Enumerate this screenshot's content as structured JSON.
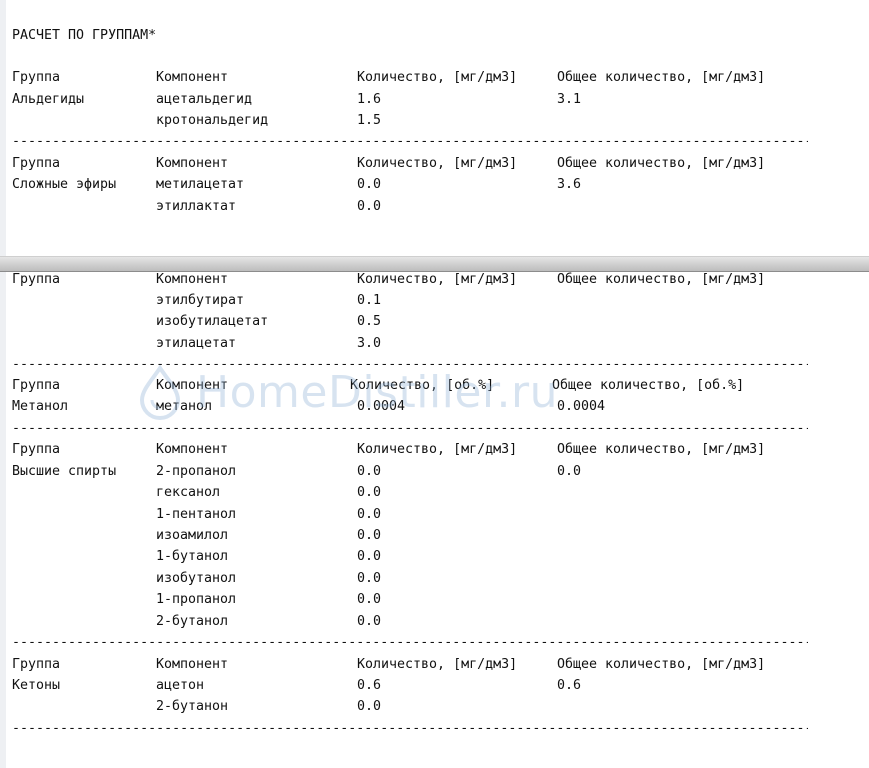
{
  "title": "РАСЧЕТ ПО ГРУППАМ*",
  "header": {
    "group": "Группа",
    "component": "Компонент",
    "qty_mg": "Количество, [мг/дм3]",
    "total_mg": "Общее количество, [мг/дм3]",
    "qty_ob": "Количество, [об.%]",
    "total_ob": "Общее количество, [об.%]"
  },
  "dashes": "-------------------------------------------------------------------------------------------------------------------",
  "aldehydes": {
    "name": "Альдегиды",
    "total": "3.1",
    "rows": [
      {
        "component": "ацетальдегид",
        "qty": "1.6"
      },
      {
        "component": "кротональдегид",
        "qty": "1.5"
      }
    ]
  },
  "esters": {
    "name": "Сложные эфиры",
    "total": "3.6",
    "rows": [
      {
        "component": "метилацетат",
        "qty": "0.0"
      },
      {
        "component": "этиллактат",
        "qty": "0.0"
      },
      {
        "component": "этилбутират",
        "qty": "0.1"
      },
      {
        "component": "изобутилацетат",
        "qty": "0.5"
      },
      {
        "component": "этилацетат",
        "qty": "3.0"
      }
    ]
  },
  "methanol": {
    "name": "Метанол",
    "total": "0.0004",
    "rows": [
      {
        "component": "метанол",
        "qty": "0.0004"
      }
    ]
  },
  "higher_alcohols": {
    "name": "Высшие спирты",
    "total": "0.0",
    "rows": [
      {
        "component": "2-пропанол",
        "qty": "0.0"
      },
      {
        "component": "гексанол",
        "qty": "0.0"
      },
      {
        "component": "1-пентанол",
        "qty": "0.0"
      },
      {
        "component": "изоамилол",
        "qty": "0.0"
      },
      {
        "component": "1-бутанол",
        "qty": "0.0"
      },
      {
        "component": "изобутанол",
        "qty": "0.0"
      },
      {
        "component": "1-пропанол",
        "qty": "0.0"
      },
      {
        "component": "2-бутанол",
        "qty": "0.0"
      }
    ]
  },
  "ketones": {
    "name": "Кетоны",
    "total": "0.6",
    "rows": [
      {
        "component": "ацетон",
        "qty": "0.6"
      },
      {
        "component": "2-бутанон",
        "qty": "0.0"
      }
    ]
  },
  "watermark_text": "HomeDistiller.ru"
}
